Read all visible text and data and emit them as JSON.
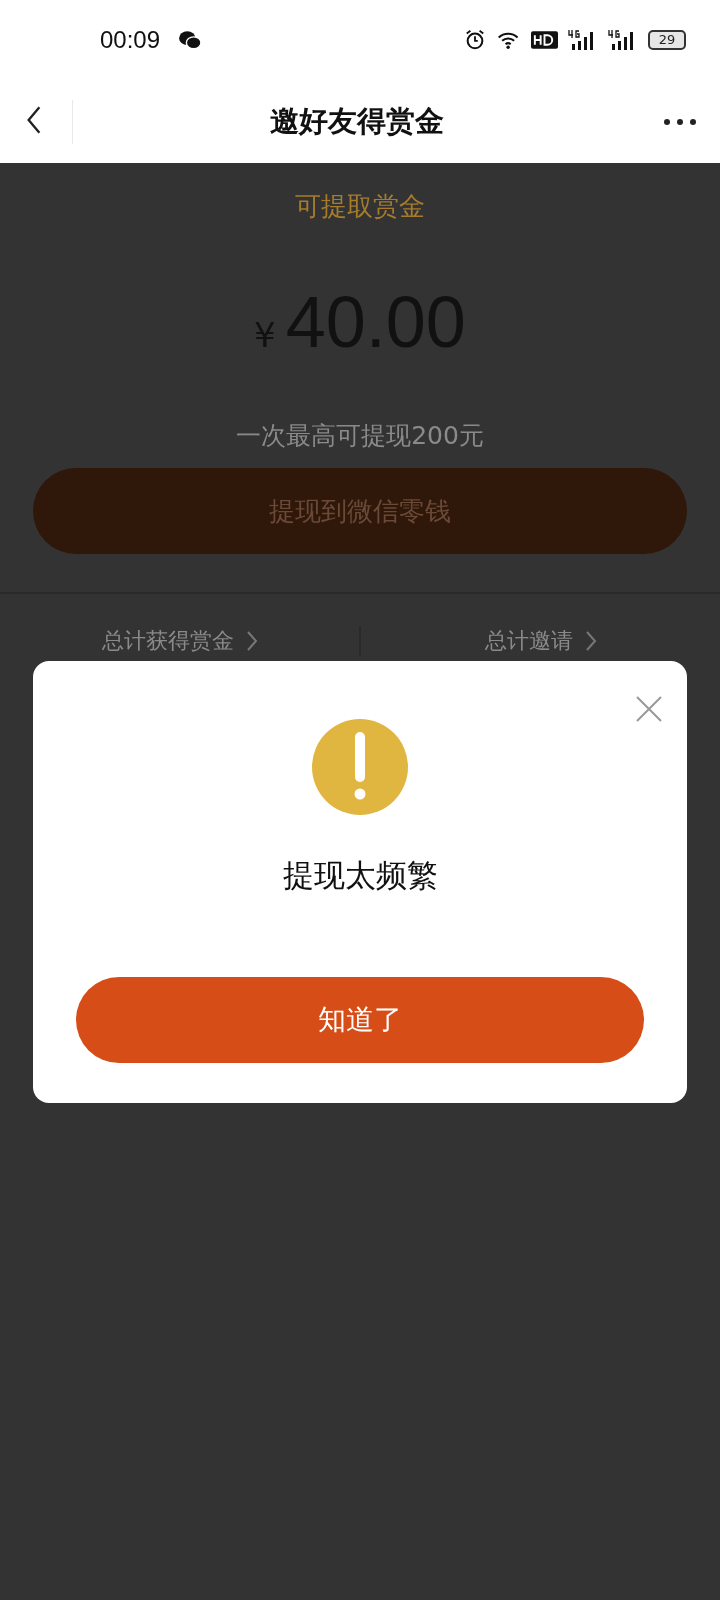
{
  "status_bar": {
    "time": "00:09",
    "battery": "29"
  },
  "header": {
    "title": "邀好友得赏金"
  },
  "reward": {
    "label": "可提取赏金",
    "currency": "¥",
    "amount": "40.00",
    "limit_note": "一次最高可提现200元",
    "withdraw_button": "提现到微信零钱"
  },
  "stats": [
    {
      "label": "总计获得赏金"
    },
    {
      "label": "总计邀请"
    }
  ],
  "dialog": {
    "message": "提现太频繁",
    "button": "知道了"
  }
}
